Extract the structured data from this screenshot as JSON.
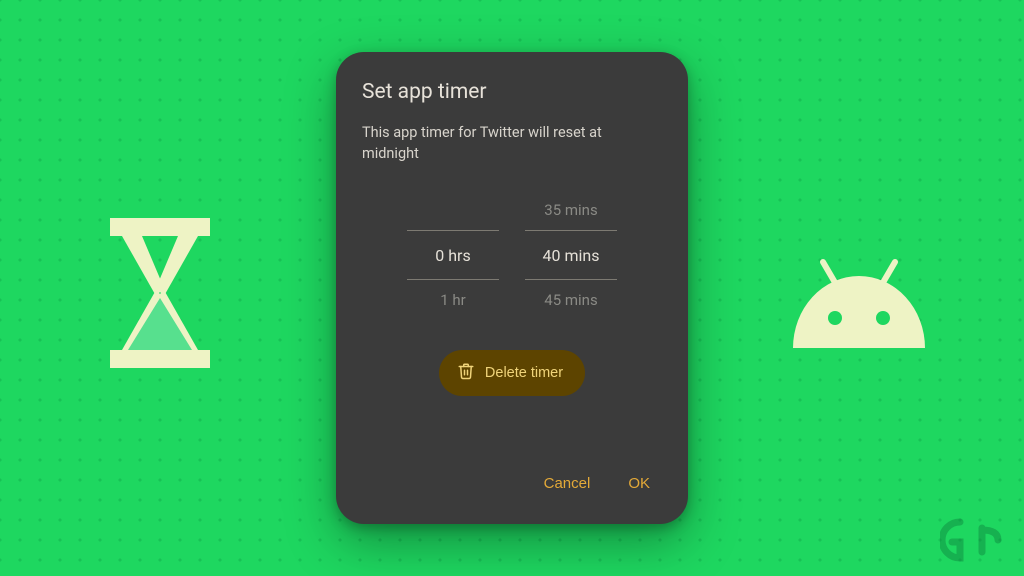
{
  "dialog": {
    "title": "Set app timer",
    "subtitle": "This app timer for Twitter will reset at midnight",
    "picker": {
      "hours": {
        "prev": "",
        "selected": "0 hrs",
        "next": "1 hr"
      },
      "minutes": {
        "prev": "35 mins",
        "selected": "40 mins",
        "next": "45 mins"
      }
    },
    "delete_label": "Delete timer",
    "cancel_label": "Cancel",
    "ok_label": "OK"
  },
  "colors": {
    "background": "#1ed760",
    "dialog_bg": "#3b3b3b",
    "accent": "#e3a938",
    "delete_bg": "#5d4400",
    "delete_fg": "#f0d47a",
    "icon_cream": "#eef3c5"
  },
  "watermark": "Gt"
}
